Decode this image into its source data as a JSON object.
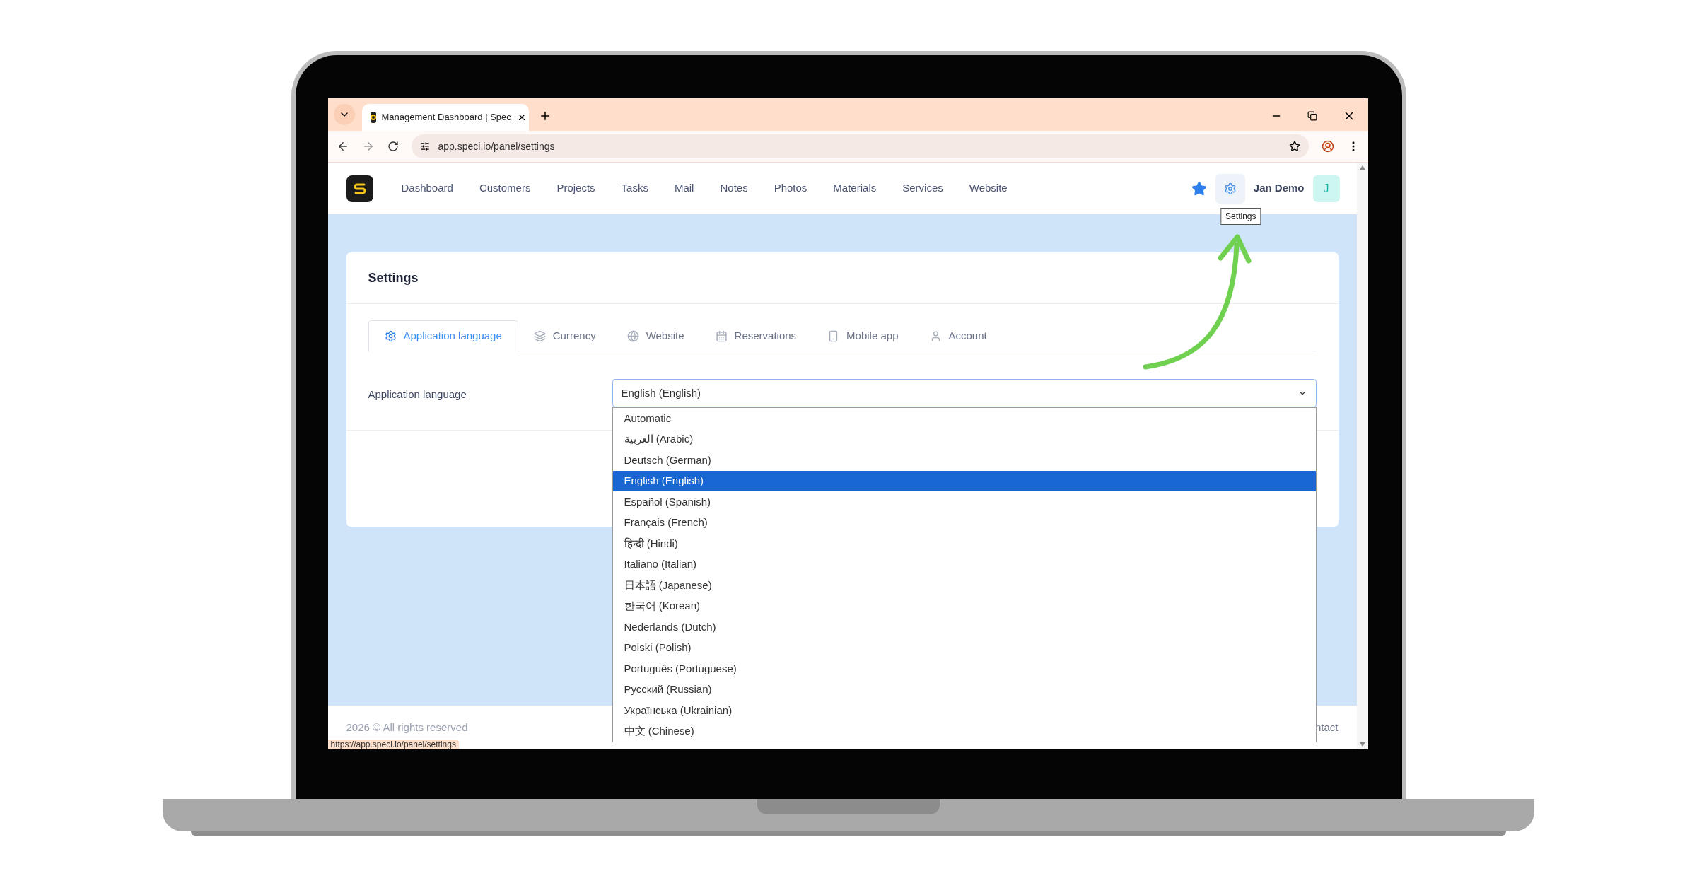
{
  "browser": {
    "tab_title": "Management Dashboard | Spec",
    "url": "app.speci.io/panel/settings",
    "status_url": "https://app.speci.io/panel/settings"
  },
  "nav": {
    "items": [
      "Dashboard",
      "Customers",
      "Projects",
      "Tasks",
      "Mail",
      "Notes",
      "Photos",
      "Materials",
      "Services",
      "Website"
    ],
    "user_name": "Jan Demo",
    "avatar_initial": "J",
    "tooltip": "Settings"
  },
  "settings": {
    "title": "Settings",
    "tabs": [
      {
        "label": "Application language",
        "selected": true
      },
      {
        "label": "Currency",
        "selected": false
      },
      {
        "label": "Website",
        "selected": false
      },
      {
        "label": "Reservations",
        "selected": false
      },
      {
        "label": "Mobile app",
        "selected": false
      },
      {
        "label": "Account",
        "selected": false
      }
    ],
    "field_label": "Application language",
    "select_value": "English (English)",
    "options": [
      {
        "label": "Automatic",
        "selected": false
      },
      {
        "label": "العربية (Arabic)",
        "selected": false
      },
      {
        "label": "Deutsch (German)",
        "selected": false
      },
      {
        "label": "English (English)",
        "selected": true
      },
      {
        "label": "Español (Spanish)",
        "selected": false
      },
      {
        "label": "Français (French)",
        "selected": false
      },
      {
        "label": "हिन्दी (Hindi)",
        "selected": false
      },
      {
        "label": "Italiano (Italian)",
        "selected": false
      },
      {
        "label": "日本語 (Japanese)",
        "selected": false
      },
      {
        "label": "한국어 (Korean)",
        "selected": false
      },
      {
        "label": "Nederlands (Dutch)",
        "selected": false
      },
      {
        "label": "Polski (Polish)",
        "selected": false
      },
      {
        "label": "Português (Portuguese)",
        "selected": false
      },
      {
        "label": "Русский (Russian)",
        "selected": false
      },
      {
        "label": "Українська (Ukrainian)",
        "selected": false
      },
      {
        "label": "中文 (Chinese)",
        "selected": false
      }
    ]
  },
  "footer": {
    "copyright": "2026 © All rights reserved",
    "link": "ntact"
  }
}
